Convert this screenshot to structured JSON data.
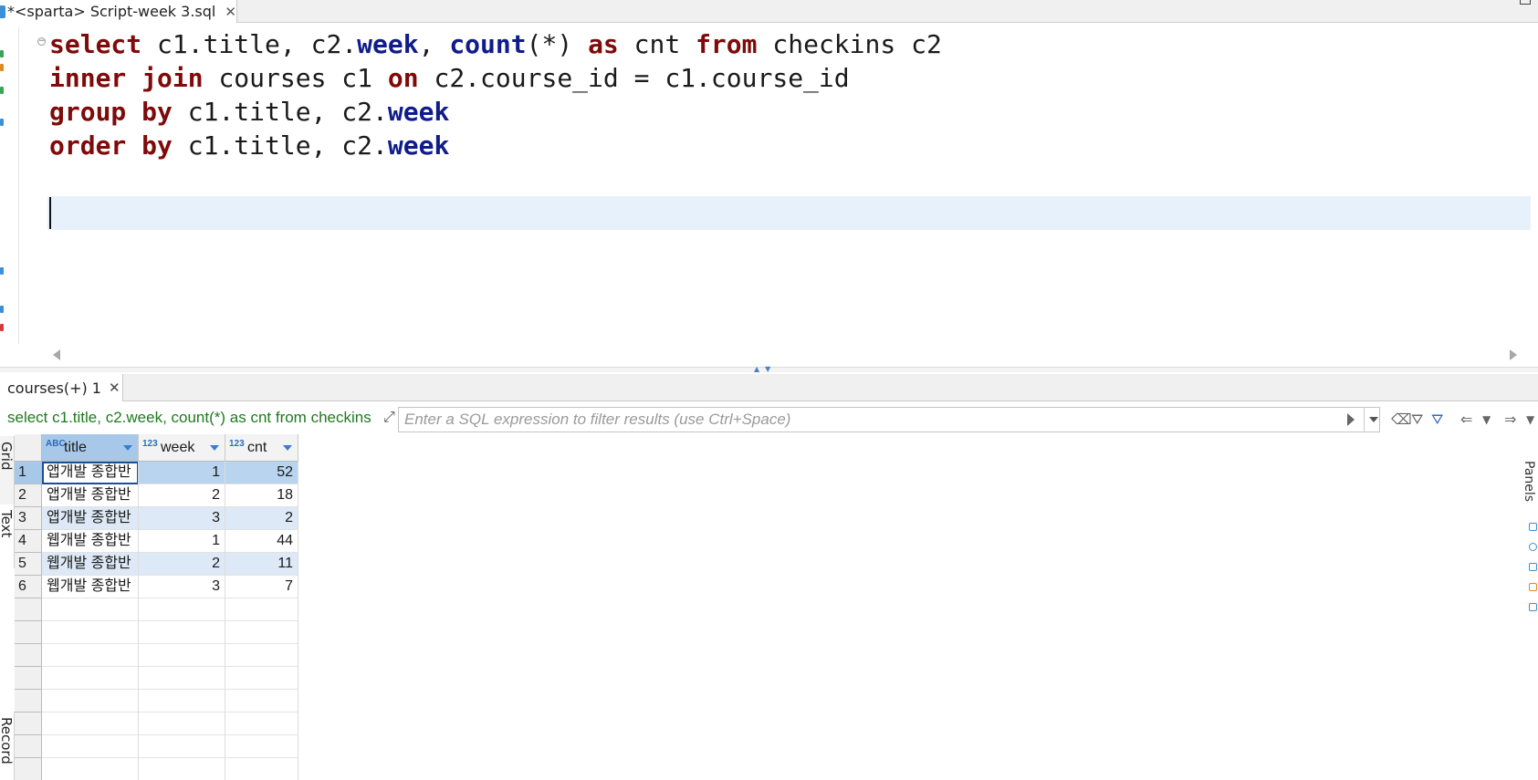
{
  "editor_tab": {
    "label": "*<sparta> Script-week 3.sql",
    "close": "✕"
  },
  "sql": {
    "lines": [
      [
        {
          "t": "select",
          "c": "kw"
        },
        {
          "t": " c1.title, c2.",
          "c": ""
        },
        {
          "t": "week",
          "c": "fn"
        },
        {
          "t": ", ",
          "c": ""
        },
        {
          "t": "count",
          "c": "fn"
        },
        {
          "t": "(*) ",
          "c": ""
        },
        {
          "t": "as",
          "c": "kw"
        },
        {
          "t": " cnt ",
          "c": ""
        },
        {
          "t": "from",
          "c": "kw"
        },
        {
          "t": " checkins c2",
          "c": ""
        }
      ],
      [
        {
          "t": "inner",
          "c": "kw"
        },
        {
          "t": " ",
          "c": ""
        },
        {
          "t": "join",
          "c": "kw"
        },
        {
          "t": " courses c1 ",
          "c": ""
        },
        {
          "t": "on",
          "c": "kw"
        },
        {
          "t": " c2.course_id = c1.course_id",
          "c": ""
        }
      ],
      [
        {
          "t": "group",
          "c": "kw"
        },
        {
          "t": " ",
          "c": ""
        },
        {
          "t": "by",
          "c": "kw"
        },
        {
          "t": " c1.title, c2.",
          "c": ""
        },
        {
          "t": "week",
          "c": "fn"
        }
      ],
      [
        {
          "t": "order",
          "c": "kw"
        },
        {
          "t": " ",
          "c": ""
        },
        {
          "t": "by",
          "c": "kw"
        },
        {
          "t": " c1.title, c2.",
          "c": ""
        },
        {
          "t": "week",
          "c": "fn"
        }
      ]
    ]
  },
  "results_tab": {
    "label": "courses(+) 1",
    "close": "✕"
  },
  "filter": {
    "sql_preview": "select c1.title, c2.week, count(*) as cnt from checkins c2",
    "placeholder": "Enter a SQL expression to filter results (use Ctrl+Space)"
  },
  "side_tabs": {
    "grid": "Grid",
    "text": "Text",
    "record": "Record",
    "panels": "Panels"
  },
  "grid": {
    "columns": [
      {
        "type": "ABC",
        "name": "title"
      },
      {
        "type": "123",
        "name": "week"
      },
      {
        "type": "123",
        "name": "cnt"
      }
    ],
    "rows": [
      {
        "n": "1",
        "title": "앱개발 종합반",
        "week": "1",
        "cnt": "52"
      },
      {
        "n": "2",
        "title": "앱개발 종합반",
        "week": "2",
        "cnt": "18"
      },
      {
        "n": "3",
        "title": "앱개발 종합반",
        "week": "3",
        "cnt": "2"
      },
      {
        "n": "4",
        "title": "웹개발 종합반",
        "week": "1",
        "cnt": "44"
      },
      {
        "n": "5",
        "title": "웹개발 종합반",
        "week": "2",
        "cnt": "11"
      },
      {
        "n": "6",
        "title": "웹개발 종합반",
        "week": "3",
        "cnt": "7"
      }
    ]
  },
  "colors": {
    "keyword": "#7f0a0a",
    "builtin": "#0f1c8a",
    "selection": "#b9d4ef",
    "accent": "#3a7bd5"
  }
}
